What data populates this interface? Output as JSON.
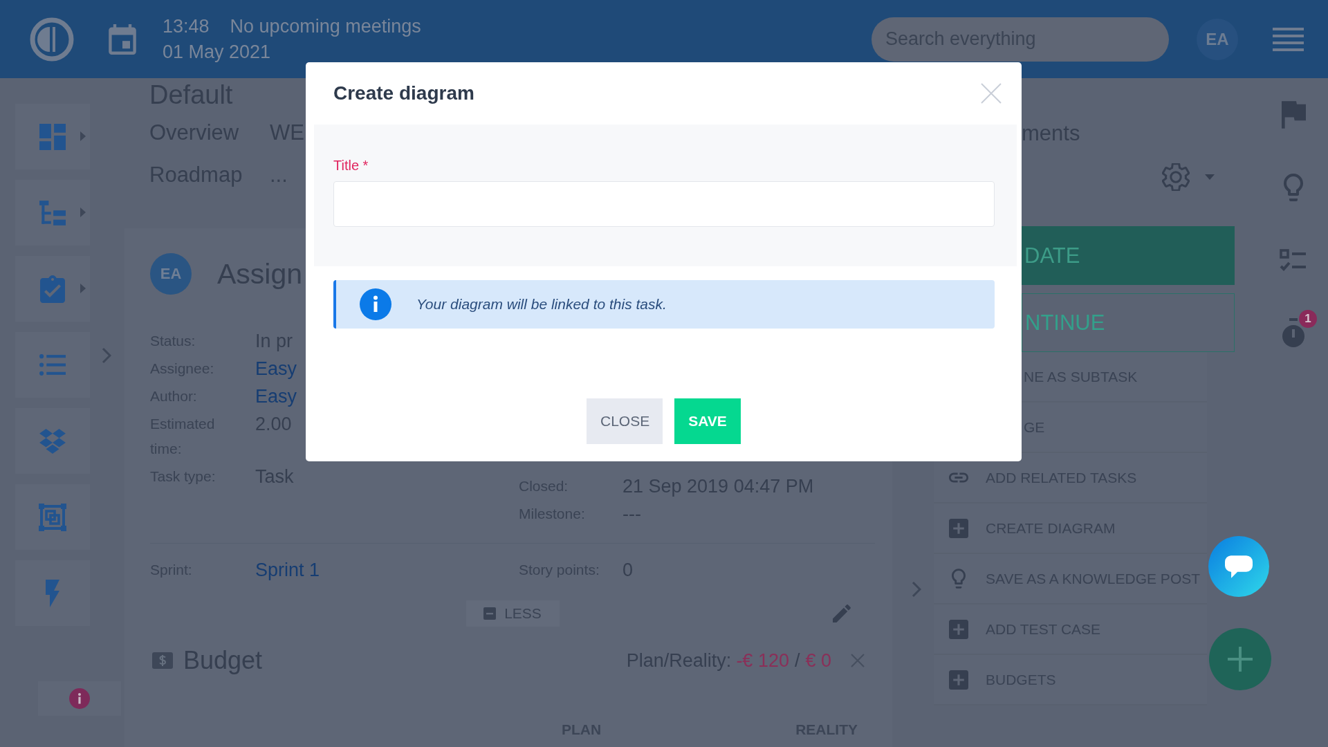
{
  "header": {
    "time": "13:48",
    "meetings": "No upcoming meetings",
    "date": "01 May 2021",
    "search": {
      "placeholder": "Search everything"
    },
    "avatar": "EA"
  },
  "sidebar": {
    "items": [
      {
        "has_submenu": true
      },
      {
        "has_submenu": true
      },
      {
        "has_submenu": true
      },
      {
        "has_submenu": false
      },
      {
        "has_submenu": false
      },
      {
        "has_submenu": false
      },
      {
        "has_submenu": false
      }
    ]
  },
  "page": {
    "title": "Default",
    "tabs": [
      {
        "label": "Overview"
      },
      {
        "label": "WE"
      },
      {
        "label": "Roadmap"
      },
      {
        "label": "..."
      }
    ]
  },
  "task": {
    "avatar": "EA",
    "title": "Assign",
    "fields_left": [
      {
        "label": "Status:",
        "value": "In pr",
        "kind": "text"
      },
      {
        "label": "Assignee:",
        "value": "Easy",
        "kind": "link"
      },
      {
        "label": "Author:",
        "value": "Easy",
        "kind": "link"
      },
      {
        "label": "Estimated time:",
        "value": "2.00",
        "kind": "text"
      },
      {
        "label": "Task type:",
        "value": "Task",
        "kind": "text"
      }
    ],
    "fields_right": [
      {
        "label": "Closed:",
        "value": "21 Sep 2019 04:47 PM",
        "kind": "text"
      },
      {
        "label": "Milestone:",
        "value": "---",
        "kind": "text"
      }
    ],
    "sprint": {
      "label": "Sprint:",
      "value": "Sprint 1",
      "kind": "link"
    },
    "story_points": {
      "label": "Story points:",
      "value": "0",
      "kind": "text"
    },
    "less_button": "LESS"
  },
  "budget": {
    "title": "Budget",
    "summary_label": "Plan/Reality:",
    "plan": "-€ 120",
    "separator": "/",
    "reality": "€ 0",
    "columns": [
      "PLAN",
      "REALITY"
    ]
  },
  "actions": {
    "tab": "ments",
    "buttons": [
      {
        "label": "DATE",
        "kind": "primary"
      },
      {
        "label": "NTINUE",
        "kind": "outline"
      }
    ],
    "items": [
      {
        "label": "NE AS SUBTASK",
        "kind": "plain"
      },
      {
        "label": "GE",
        "kind": "plain"
      },
      {
        "label": "ADD RELATED TASKS",
        "kind": "relation"
      },
      {
        "label": "CREATE DIAGRAM",
        "kind": "add"
      },
      {
        "label": "SAVE AS A KNOWLEDGE POST",
        "kind": "idea"
      },
      {
        "label": "ADD TEST CASE",
        "kind": "add"
      },
      {
        "label": "BUDGETS",
        "kind": "add"
      }
    ]
  },
  "rail": {
    "timer_badge": "1"
  },
  "modal": {
    "title": "Create diagram",
    "field": {
      "label": "Title *"
    },
    "info": "Your diagram will be linked to this task.",
    "buttons": [
      {
        "label": "CLOSE",
        "kind": "secondary"
      },
      {
        "label": "SAVE",
        "kind": "primary"
      }
    ]
  }
}
